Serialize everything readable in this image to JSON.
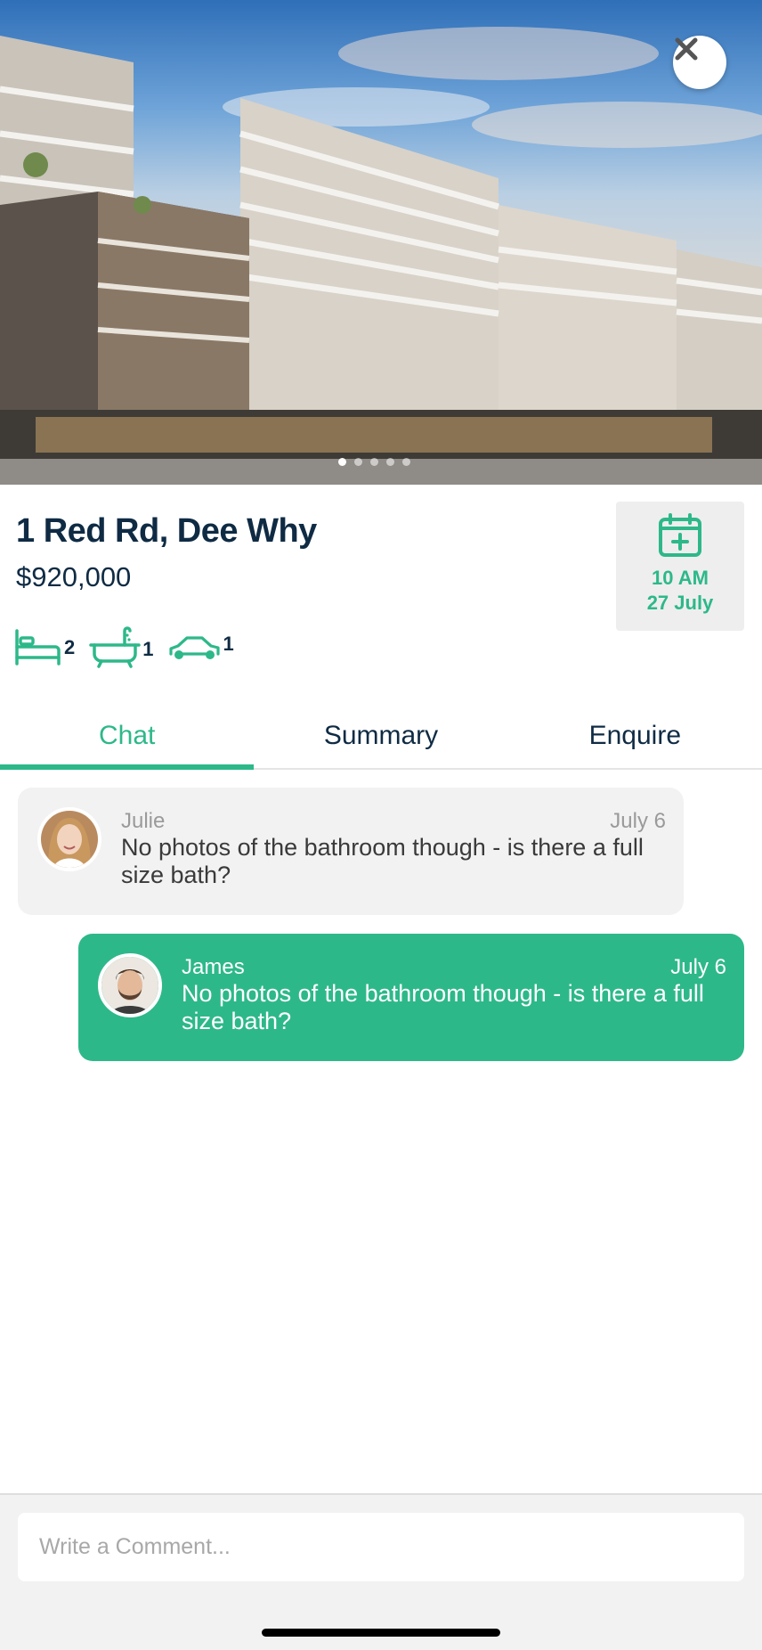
{
  "listing": {
    "address": "1 Red Rd, Dee Why",
    "price": "$920,000",
    "features": [
      {
        "icon": "bed-icon",
        "count": "2"
      },
      {
        "icon": "bathtub-icon",
        "count": "1"
      },
      {
        "icon": "car-icon",
        "count": "1"
      }
    ]
  },
  "inspection": {
    "icon": "calendar-add-icon",
    "time": "10 AM",
    "date": "27 July"
  },
  "tabs": [
    {
      "label": "Chat",
      "active": true
    },
    {
      "label": "Summary",
      "active": false
    },
    {
      "label": "Enquire",
      "active": false
    }
  ],
  "messages": [
    {
      "author": "Julie",
      "date": "July 6",
      "text": "No photos of the bathroom though - is there a full size bath?",
      "direction": "incoming"
    },
    {
      "author": "James",
      "date": "July 6",
      "text": "No photos of the bathroom though - is there a full size bath?",
      "direction": "outgoing"
    }
  ],
  "composer": {
    "placeholder": "Write a Comment..."
  },
  "colors": {
    "accent": "#2db88a",
    "text_dark": "#0f2b44",
    "bubble_incoming": "#f2f2f2"
  },
  "gallery": {
    "current": 1,
    "total": 5
  }
}
